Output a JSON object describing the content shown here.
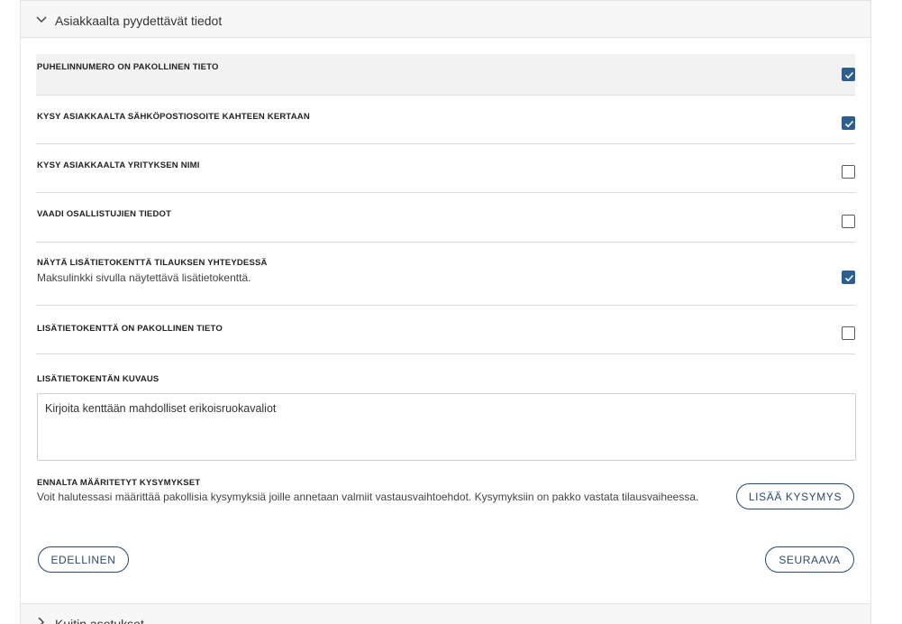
{
  "section": {
    "title": "Asiakkaalta pyydettävät tiedot",
    "icon": "chevron-down-icon"
  },
  "settings": [
    {
      "label": "PUHELINNUMERO ON PAKOLLINEN TIETO",
      "checked": true
    },
    {
      "label": "KYSY ASIAKKAALTA SÄHKÖPOSTIOSOITE KAHTEEN KERTAAN",
      "checked": true
    },
    {
      "label": "KYSY ASIAKKAALTA YRITYKSEN NIMI",
      "checked": false
    },
    {
      "label": "VAADI OSALLISTUJIEN TIEDOT",
      "checked": false
    },
    {
      "label": "NÄYTÄ LISÄTIETOKENTTÄ TILAUKSEN YHTEYDESSÄ",
      "description": "Maksulinkki sivulla näytettävä lisätietokenttä.",
      "checked": true
    },
    {
      "label": "LISÄTIETOKENTTÄ ON PAKOLLINEN TIETO",
      "checked": false
    }
  ],
  "extra_field": {
    "label": "LISÄTIETOKENTÄN KUVAUS",
    "value": "Kirjoita kenttään mahdolliset erikoisruokavaliot"
  },
  "predefined_questions": {
    "label": "ENNALTA MÄÄRITETYT KYSYMYKSET",
    "description": "Voit halutessasi määrittää pakollisia kysymyksiä joille annetaan valmiit vastausvaihtoehdot. Kysymyksiin on pakko vastata tilausvaiheessa.",
    "add_button": "LISÄÄ KYSYMYS"
  },
  "navigation": {
    "previous": "EDELLINEN",
    "next": "SEURAAVA"
  },
  "next_section": {
    "title": "Kuitin asetukset",
    "icon": "chevron-right-icon"
  },
  "colors": {
    "checkbox_checked": "#2c5f8f",
    "button_border": "#2c4a6e"
  }
}
